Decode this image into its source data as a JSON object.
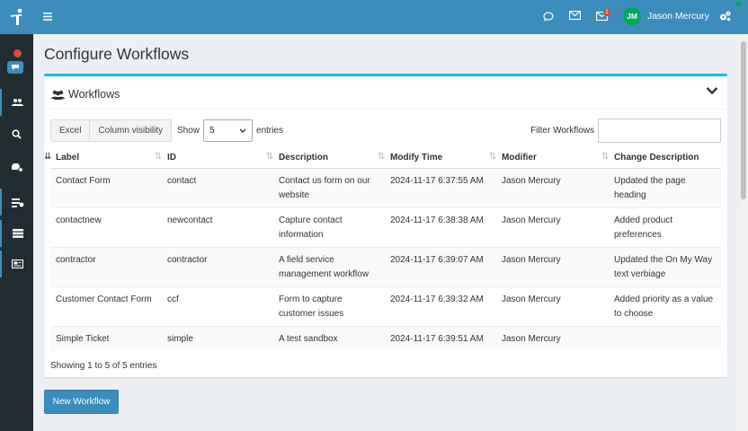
{
  "navbar": {
    "user_initials": "JM",
    "user_name": "Jason Mercury",
    "mail_badge": "1"
  },
  "page": {
    "title": "Configure Workflows"
  },
  "workflows_box": {
    "title": "Workflows",
    "buttons": {
      "excel": "Excel",
      "column_visibility": "Column visibility"
    },
    "length": {
      "show_label": "Show",
      "value": "5",
      "entries_label": "entries"
    },
    "filter_label": "Filter Workflows",
    "filter_value": "",
    "columns": [
      "Label",
      "ID",
      "Description",
      "Modify Time",
      "Modifier",
      "Change Description"
    ],
    "rows": [
      {
        "label": "Contact Form",
        "id": "contact",
        "description": "Contact us form on our website",
        "modify_time": "2024-11-17 6:37:55 AM",
        "modifier": "Jason Mercury",
        "change": "Updated the page heading"
      },
      {
        "label": "contactnew",
        "id": "newcontact",
        "description": "Capture contact information",
        "modify_time": "2024-11-17 6:38:38 AM",
        "modifier": "Jason Mercury",
        "change": "Added product preferences"
      },
      {
        "label": "contractor",
        "id": "contractor",
        "description": "A field service management workflow",
        "modify_time": "2024-11-17 6:39:07 AM",
        "modifier": "Jason Mercury",
        "change": "Updated the On My Way text verbiage"
      },
      {
        "label": "Customer Contact Form",
        "id": "ccf",
        "description": "Form to capture customer issues",
        "modify_time": "2024-11-17 6:39:32 AM",
        "modifier": "Jason Mercury",
        "change": "Added priority as a value to choose"
      },
      {
        "label": "Simple Ticket",
        "id": "simple",
        "description": "A test sandbox",
        "modify_time": "2024-11-17 6:39:51 AM",
        "modifier": "Jason Mercury",
        "change": ""
      }
    ],
    "info": "Showing 1 to 5 of 5 entries"
  },
  "new_workflow_label": "New Workflow",
  "colors": {
    "primary": "#3c8dbc",
    "sidebar": "#222d32",
    "box_accent": "#00c0ef",
    "avatar": "#00a65a",
    "danger": "#dd4b39"
  }
}
